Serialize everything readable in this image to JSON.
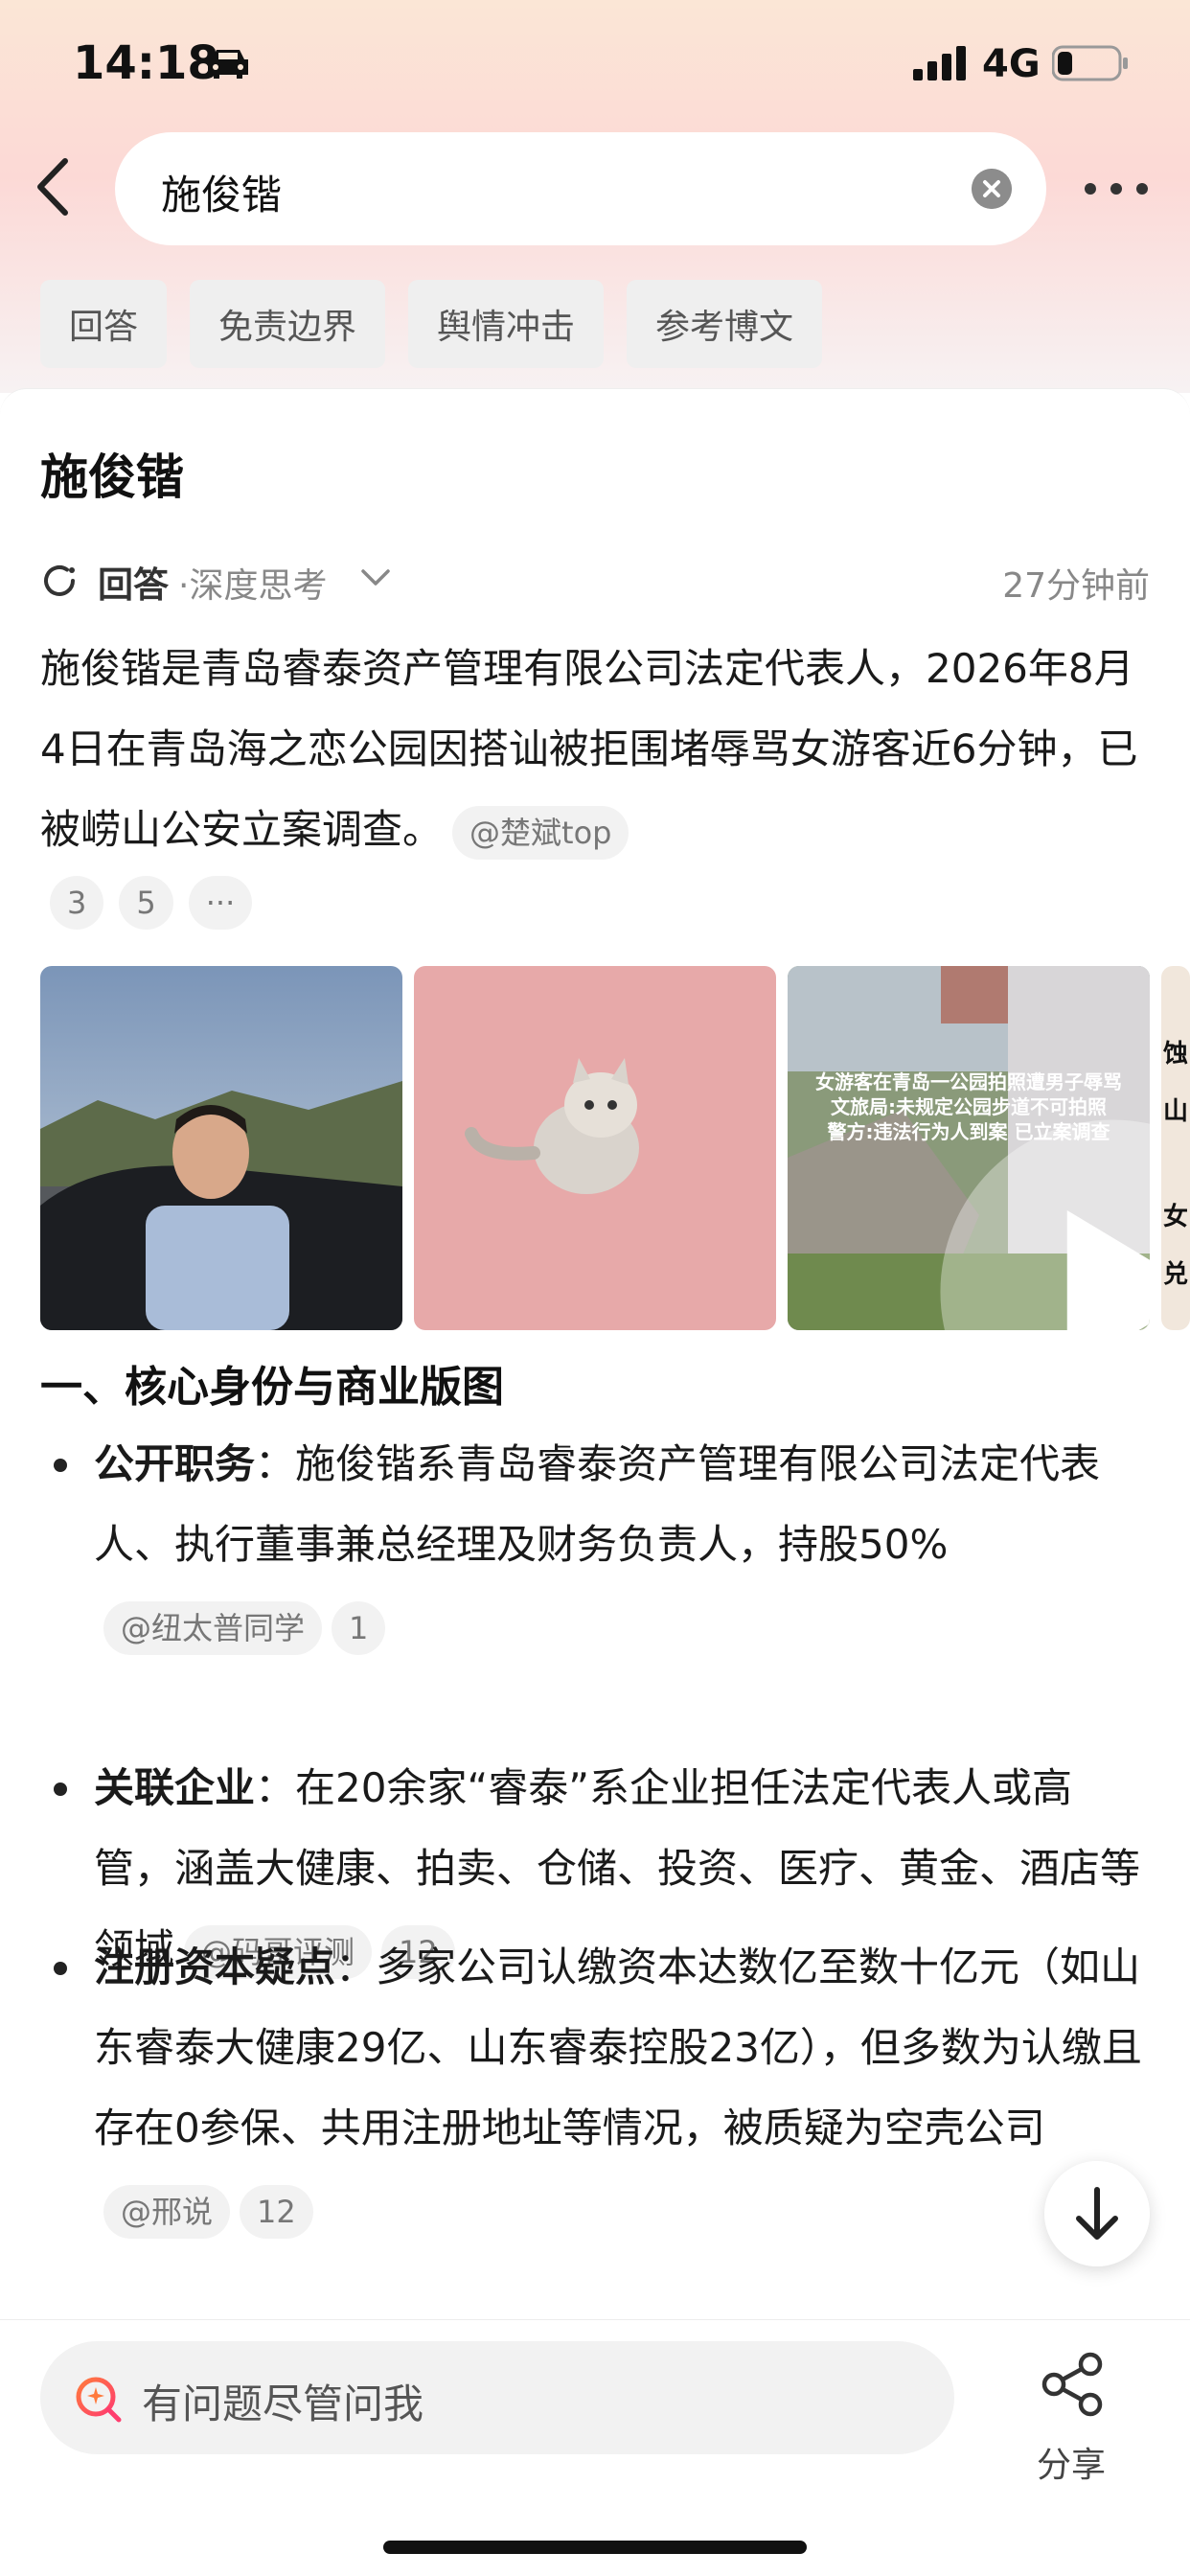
{
  "status_bar": {
    "time": "14:18",
    "network": "4G",
    "icons": [
      "car-icon",
      "signal-icon",
      "battery-icon"
    ],
    "battery_level": 0.25
  },
  "search": {
    "query": "施俊锴",
    "icons": [
      "back-arrow-icon",
      "clear-icon",
      "more-icon"
    ]
  },
  "tabs": [
    "回答",
    "免责边界",
    "舆情冲击",
    "参考博文"
  ],
  "answer": {
    "title": "施俊锴",
    "tag": "回答",
    "mode": "·深度思考",
    "time_ago": "27分钟前",
    "intro": "施俊锴是青岛睿泰资产管理有限公司法定代表人，2026年8月4日在青岛海之恋公园因搭讪被拒围堵辱骂女游客近6分钟，已被崂山公安立案调查。",
    "intro_cite": "@楚斌top",
    "refs": [
      "3",
      "5",
      "···"
    ],
    "images": [
      {
        "name": "man-portrait-image"
      },
      {
        "name": "cat-image"
      },
      {
        "name": "news-video-image",
        "caption_lines": [
          "女游客在青岛一公园拍照遭男子辱骂",
          "文旅局:未规定公园步道不可拍照",
          "警方:违法行为人到案 已立案调查"
        ]
      },
      {
        "name": "partial-news-image",
        "caption_lines": [
          "蚀",
          "山",
          "女",
          "兑"
        ]
      }
    ],
    "section_heading": "一、核心身份与商业版图",
    "bullets": [
      {
        "title": "公开职务",
        "text": "：施俊锴系青岛睿泰资产管理有限公司法定代表人、执行董事兼总经理及财务负责人，持股50%",
        "cite": "@纽太普同学",
        "ref": "1"
      },
      {
        "title": "关联企业",
        "text": "：在20余家“睿泰”系企业担任法定代表人或高管，涵盖大健康、拍卖、仓储、投资、医疗、黄金、酒店等领域",
        "cite": "@码哥评测",
        "ref": "12"
      },
      {
        "title": "注册资本疑点",
        "text": "：多家公司认缴资本达数亿至数十亿元（如山东睿泰大健康29亿、山东睿泰控股23亿），但多数为认缴且存在0参保、共用注册地址等情况，被质疑为空壳公司",
        "cite": "@邢说",
        "ref": "12"
      }
    ]
  },
  "bottom": {
    "ask_placeholder": "有问题尽管问我",
    "share_label": "分享"
  },
  "colors": {
    "header_gradient_top": "#fbe6d6",
    "header_gradient_mid": "#fcd9d6",
    "chip_bg": "#f2f2f2",
    "tab_bg": "#efefef"
  }
}
